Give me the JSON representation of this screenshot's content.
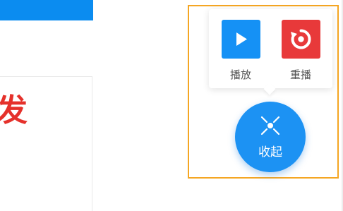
{
  "left_card": {
    "big_text": "发"
  },
  "popup_menu": {
    "items": [
      {
        "label": "播放",
        "icon": "play-icon",
        "color": "#1591f5"
      },
      {
        "label": "重播",
        "icon": "replay-icon",
        "color": "#e8393a"
      }
    ]
  },
  "fab": {
    "label": "收起",
    "icon": "collapse-icon",
    "color": "#1c92f3"
  },
  "colors": {
    "highlight_frame": "#f5a623",
    "top_strip": "#0b8cf0",
    "accent_text": "#e5312b"
  }
}
